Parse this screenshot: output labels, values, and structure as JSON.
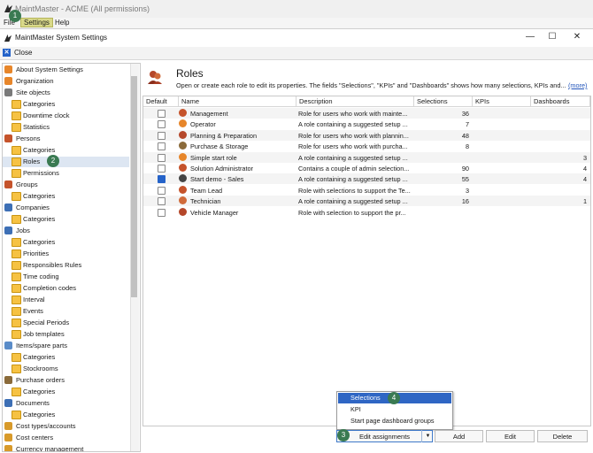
{
  "app": {
    "title": "MaintMaster - ACME (All permissions)"
  },
  "menu": {
    "file": "File",
    "settings": "Settings",
    "help": "Help"
  },
  "dialog": {
    "title": "MaintMaster System Settings",
    "close_label": "Close",
    "win_controls": [
      "—",
      "☐",
      "✕"
    ]
  },
  "sidebar": {
    "items": [
      {
        "label": "About System Settings",
        "indent": 0,
        "icon": "shield-icon"
      },
      {
        "label": "Organization",
        "indent": 0,
        "icon": "shield-icon"
      },
      {
        "label": "Site objects",
        "indent": 0,
        "icon": "site-icon"
      },
      {
        "label": "Categories",
        "indent": 1,
        "icon": "folder-icon"
      },
      {
        "label": "Downtime clock",
        "indent": 1,
        "icon": "folder-icon"
      },
      {
        "label": "Statistics",
        "indent": 1,
        "icon": "folder-icon"
      },
      {
        "label": "Persons",
        "indent": 0,
        "icon": "person-icon"
      },
      {
        "label": "Categories",
        "indent": 1,
        "icon": "folder-icon"
      },
      {
        "label": "Roles",
        "indent": 1,
        "icon": "folder-icon",
        "selected": true
      },
      {
        "label": "Permissions",
        "indent": 1,
        "icon": "folder-icon"
      },
      {
        "label": "Groups",
        "indent": 0,
        "icon": "groups-icon"
      },
      {
        "label": "Categories",
        "indent": 1,
        "icon": "folder-icon"
      },
      {
        "label": "Companies",
        "indent": 0,
        "icon": "companies-icon"
      },
      {
        "label": "Categories",
        "indent": 1,
        "icon": "folder-icon"
      },
      {
        "label": "Jobs",
        "indent": 0,
        "icon": "jobs-icon"
      },
      {
        "label": "Categories",
        "indent": 1,
        "icon": "folder-icon"
      },
      {
        "label": "Priorities",
        "indent": 1,
        "icon": "folder-icon"
      },
      {
        "label": "Responsibles Rules",
        "indent": 1,
        "icon": "folder-icon"
      },
      {
        "label": "Time coding",
        "indent": 1,
        "icon": "folder-icon"
      },
      {
        "label": "Completion codes",
        "indent": 1,
        "icon": "folder-icon"
      },
      {
        "label": "Interval",
        "indent": 1,
        "icon": "folder-icon"
      },
      {
        "label": "Events",
        "indent": 1,
        "icon": "folder-icon"
      },
      {
        "label": "Special Periods",
        "indent": 1,
        "icon": "folder-icon"
      },
      {
        "label": "Job templates",
        "indent": 1,
        "icon": "folder-icon"
      },
      {
        "label": "Items/spare parts",
        "indent": 0,
        "icon": "items-icon"
      },
      {
        "label": "Categories",
        "indent": 1,
        "icon": "folder-icon"
      },
      {
        "label": "Stockrooms",
        "indent": 1,
        "icon": "folder-icon"
      },
      {
        "label": "Purchase orders",
        "indent": 0,
        "icon": "purchase-icon"
      },
      {
        "label": "Categories",
        "indent": 1,
        "icon": "folder-icon"
      },
      {
        "label": "Documents",
        "indent": 0,
        "icon": "documents-icon"
      },
      {
        "label": "Categories",
        "indent": 1,
        "icon": "folder-icon"
      },
      {
        "label": "Cost types/accounts",
        "indent": 0,
        "icon": "cost-icon"
      },
      {
        "label": "Cost centers",
        "indent": 0,
        "icon": "cost-icon"
      },
      {
        "label": "Currency management",
        "indent": 0,
        "icon": "cost-icon"
      }
    ]
  },
  "roles": {
    "title": "Roles",
    "description": "Open or create each role to edit its properties. The fields \"Selections\", \"KPIs\" and \"Dashboards\" shows how many selections, KPIs and...",
    "more": "(more)",
    "columns": [
      "Default",
      "Name",
      "Description",
      "Selections",
      "KPIs",
      "Dashboards"
    ],
    "rows": [
      {
        "default": false,
        "name": "Management",
        "description": "Role for users who work with mainte...",
        "selections": "36",
        "kpis": "",
        "dashboards": ""
      },
      {
        "default": false,
        "name": "Operator",
        "description": "A role containing a suggested setup ...",
        "selections": "7",
        "kpis": "",
        "dashboards": ""
      },
      {
        "default": false,
        "name": "Planning & Preparation",
        "description": "Role for users who work with plannin...",
        "selections": "48",
        "kpis": "",
        "dashboards": ""
      },
      {
        "default": false,
        "name": "Purchase & Storage",
        "description": "Role for users who work with purcha...",
        "selections": "8",
        "kpis": "",
        "dashboards": ""
      },
      {
        "default": false,
        "name": "Simple start role",
        "description": "A role containing a suggested setup ...",
        "selections": "",
        "kpis": "",
        "dashboards": "3"
      },
      {
        "default": false,
        "name": "Solution Administrator",
        "description": "Contains a couple of admin selection...",
        "selections": "90",
        "kpis": "",
        "dashboards": "4"
      },
      {
        "default": true,
        "name": "Start demo - Sales",
        "description": "A role containing a suggested setup ...",
        "selections": "55",
        "kpis": "",
        "dashboards": "4"
      },
      {
        "default": false,
        "name": "Team Lead",
        "description": "Role with selections to support the Te...",
        "selections": "3",
        "kpis": "",
        "dashboards": ""
      },
      {
        "default": false,
        "name": "Technician",
        "description": "A role containing a suggested setup ...",
        "selections": "16",
        "kpis": "",
        "dashboards": "1"
      },
      {
        "default": false,
        "name": "Vehicle Manager",
        "description": "Role with selection to support the pr...",
        "selections": "",
        "kpis": "",
        "dashboards": ""
      }
    ]
  },
  "buttons": {
    "edit_assignments": "Edit assignments",
    "add": "Add",
    "edit": "Edit",
    "delete": "Delete"
  },
  "dropdown": {
    "items": [
      "Selections",
      "KPI",
      "Start page dashboard groups"
    ],
    "selected": "Selections"
  },
  "steps": [
    "1",
    "2",
    "3",
    "4"
  ],
  "colors": {
    "step_badge": "#3a7a52",
    "selection_blue": "#2f66c4",
    "folder": "#f6c243"
  }
}
